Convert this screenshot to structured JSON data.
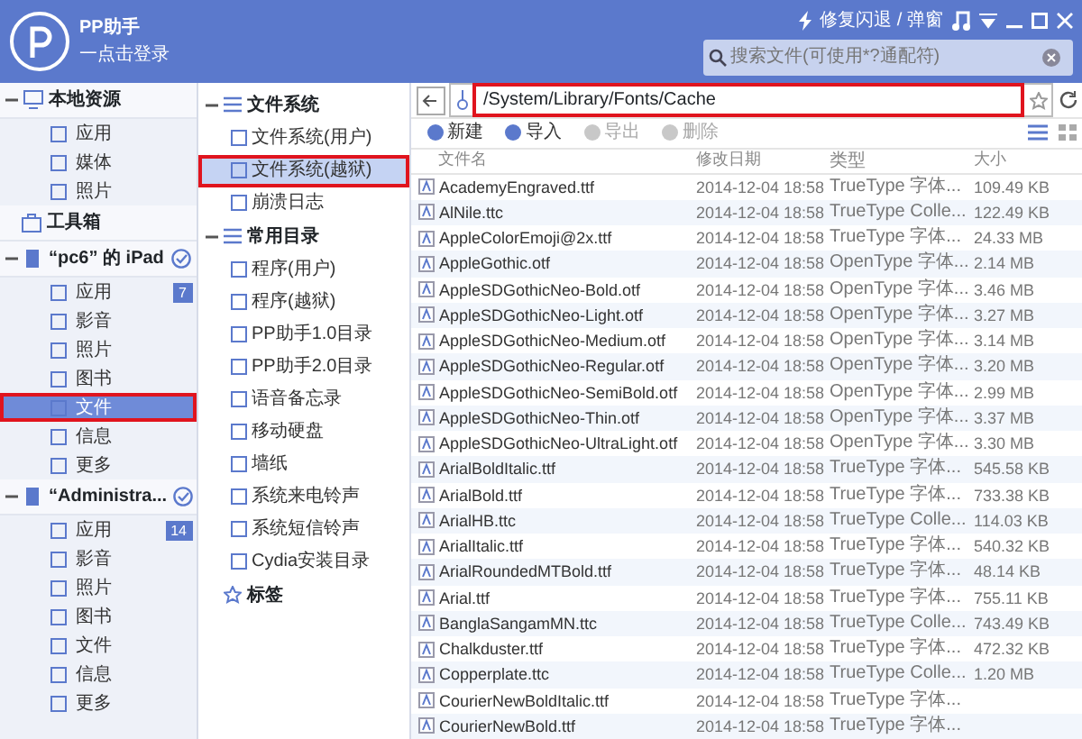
{
  "app": {
    "title": "PP助手",
    "login": "一点击登录",
    "repair": "修复闪退 / 弹窗",
    "search": {
      "placeholder": "搜索文件(可使用*?通配符)"
    }
  },
  "sidebar": [
    {
      "kind": "section",
      "label": "本地资源",
      "expanded": true,
      "children": [
        {
          "label": "应用",
          "selected": false
        },
        {
          "label": "媒体",
          "selected": false
        },
        {
          "label": "照片",
          "selected": false
        }
      ]
    },
    {
      "kind": "tool",
      "label": "工具箱"
    },
    {
      "kind": "device",
      "label": "“pc6” 的 iPad",
      "expanded": true,
      "connected": true,
      "children": [
        {
          "label": "应用",
          "badge": "7",
          "selected": false
        },
        {
          "label": "影音",
          "selected": false
        },
        {
          "label": "照片",
          "selected": false
        },
        {
          "label": "图书",
          "selected": false
        },
        {
          "label": "文件",
          "selected": true
        },
        {
          "label": "信息",
          "selected": false
        },
        {
          "label": "更多",
          "selected": false
        }
      ]
    },
    {
      "kind": "device",
      "label": "“Administra...",
      "expanded": true,
      "connected": true,
      "children": [
        {
          "label": "应用",
          "badge": "14",
          "selected": false
        },
        {
          "label": "影音",
          "selected": false
        },
        {
          "label": "照片",
          "selected": false
        },
        {
          "label": "图书",
          "selected": false
        },
        {
          "label": "文件",
          "selected": false
        },
        {
          "label": "信息",
          "selected": false
        },
        {
          "label": "更多",
          "selected": false
        }
      ]
    }
  ],
  "tree": [
    {
      "label": "文件系统",
      "expanded": true,
      "children": [
        {
          "label": "文件系统(用户)",
          "selected": false
        },
        {
          "label": "文件系统(越狱)",
          "selected": true
        },
        {
          "label": "崩溃日志",
          "selected": false
        }
      ]
    },
    {
      "label": "常用目录",
      "expanded": true,
      "children": [
        {
          "label": "程序(用户)",
          "selected": false
        },
        {
          "label": "程序(越狱)",
          "selected": false
        },
        {
          "label": "PP助手1.0目录",
          "selected": false
        },
        {
          "label": "PP助手2.0目录",
          "selected": false
        },
        {
          "label": "语音备忘录",
          "selected": false
        },
        {
          "label": "移动硬盘",
          "selected": false
        },
        {
          "label": "墙纸",
          "selected": false
        },
        {
          "label": "系统来电铃声",
          "selected": false
        },
        {
          "label": "系统短信铃声",
          "selected": false
        },
        {
          "label": "Cydia安装目录",
          "selected": false
        }
      ]
    },
    {
      "label": "标签"
    }
  ],
  "path": "/System/Library/Fonts/Cache",
  "toolbar": [
    {
      "label": "新建",
      "disabled": false
    },
    {
      "label": "导入",
      "disabled": false
    },
    {
      "label": "导出",
      "disabled": true
    },
    {
      "label": "删除",
      "disabled": true
    }
  ],
  "table": {
    "columns": [
      "文件名",
      "修改日期",
      "类型",
      "大小"
    ],
    "rows": [
      [
        "AcademyEngraved.ttf",
        "2014-12-04 18:58",
        "TrueType 字体...",
        "109.49 KB"
      ],
      [
        "AlNile.ttc",
        "2014-12-04 18:58",
        "TrueType Colle...",
        "122.49 KB"
      ],
      [
        "AppleColorEmoji@2x.ttf",
        "2014-12-04 18:58",
        "TrueType 字体...",
        "24.33 MB"
      ],
      [
        "AppleGothic.otf",
        "2014-12-04 18:58",
        "OpenType 字体...",
        "2.14 MB"
      ],
      [
        "AppleSDGothicNeo-Bold.otf",
        "2014-12-04 18:58",
        "OpenType 字体...",
        "3.46 MB"
      ],
      [
        "AppleSDGothicNeo-Light.otf",
        "2014-12-04 18:58",
        "OpenType 字体...",
        "3.27 MB"
      ],
      [
        "AppleSDGothicNeo-Medium.otf",
        "2014-12-04 18:58",
        "OpenType 字体...",
        "3.14 MB"
      ],
      [
        "AppleSDGothicNeo-Regular.otf",
        "2014-12-04 18:58",
        "OpenType 字体...",
        "3.20 MB"
      ],
      [
        "AppleSDGothicNeo-SemiBold.otf",
        "2014-12-04 18:58",
        "OpenType 字体...",
        "2.99 MB"
      ],
      [
        "AppleSDGothicNeo-Thin.otf",
        "2014-12-04 18:58",
        "OpenType 字体...",
        "3.37 MB"
      ],
      [
        "AppleSDGothicNeo-UltraLight.otf",
        "2014-12-04 18:58",
        "OpenType 字体...",
        "3.30 MB"
      ],
      [
        "ArialBoldItalic.ttf",
        "2014-12-04 18:58",
        "TrueType 字体...",
        "545.58 KB"
      ],
      [
        "ArialBold.ttf",
        "2014-12-04 18:58",
        "TrueType 字体...",
        "733.38 KB"
      ],
      [
        "ArialHB.ttc",
        "2014-12-04 18:58",
        "TrueType Colle...",
        "114.03 KB"
      ],
      [
        "ArialItalic.ttf",
        "2014-12-04 18:58",
        "TrueType 字体...",
        "540.32 KB"
      ],
      [
        "ArialRoundedMTBold.ttf",
        "2014-12-04 18:58",
        "TrueType 字体...",
        "48.14 KB"
      ],
      [
        "Arial.ttf",
        "2014-12-04 18:58",
        "TrueType 字体...",
        "755.11 KB"
      ],
      [
        "BanglaSangamMN.ttc",
        "2014-12-04 18:58",
        "TrueType Colle...",
        "743.49 KB"
      ],
      [
        "Chalkduster.ttf",
        "2014-12-04 18:58",
        "TrueType 字体...",
        "472.32 KB"
      ],
      [
        "Copperplate.ttc",
        "2014-12-04 18:58",
        "TrueType Colle...",
        "1.20 MB"
      ],
      [
        "CourierNewBoldItalic.ttf",
        "2014-12-04 18:58",
        "TrueType 字体..."
      ],
      [
        "CourierNewBold.ttf",
        "2014-12-04 18:58",
        "TrueType 字体..."
      ]
    ]
  }
}
